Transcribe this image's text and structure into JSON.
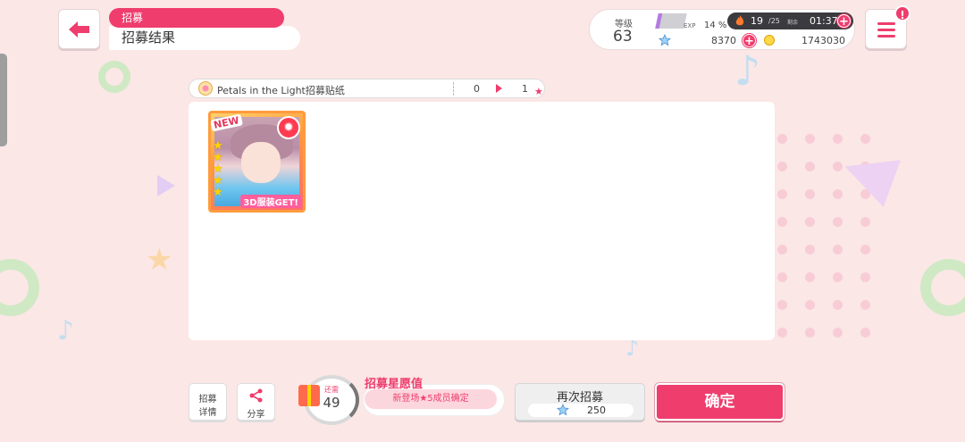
{
  "header": {
    "category": "招募",
    "title": "招募结果"
  },
  "status": {
    "level_label": "等级",
    "level": "63",
    "exp_label": "EXP",
    "exp_percent": "14 %",
    "exp_fraction": 0.14,
    "stamina_current": "19",
    "stamina_max": "/25",
    "remaining_label": "剩余",
    "stamina_timer": "01:37",
    "star_gems": "8370",
    "coins": "1743030"
  },
  "menu": {
    "alert_badge": "!"
  },
  "item_bar": {
    "name": "Petals in the Light招募贴纸",
    "count_before": "0",
    "count_after": "1"
  },
  "result_card": {
    "new_badge": "NEW",
    "rarity_stars": 5,
    "costume_tag": "3D服装GET!",
    "attribute": "fire"
  },
  "bottom": {
    "detail_label_line1": "招募",
    "detail_label_line2": "详情",
    "share_label": "分享",
    "wish_remaining_label": "还需",
    "wish_remaining": "49",
    "wish_title": "招募星愿值",
    "wish_subtitle": "新登场★5成员确定",
    "again_label": "再次招募",
    "again_cost": "250",
    "confirm_label": "确定"
  },
  "colors": {
    "accent": "#ef3d6d",
    "background": "#fbe7e6"
  }
}
